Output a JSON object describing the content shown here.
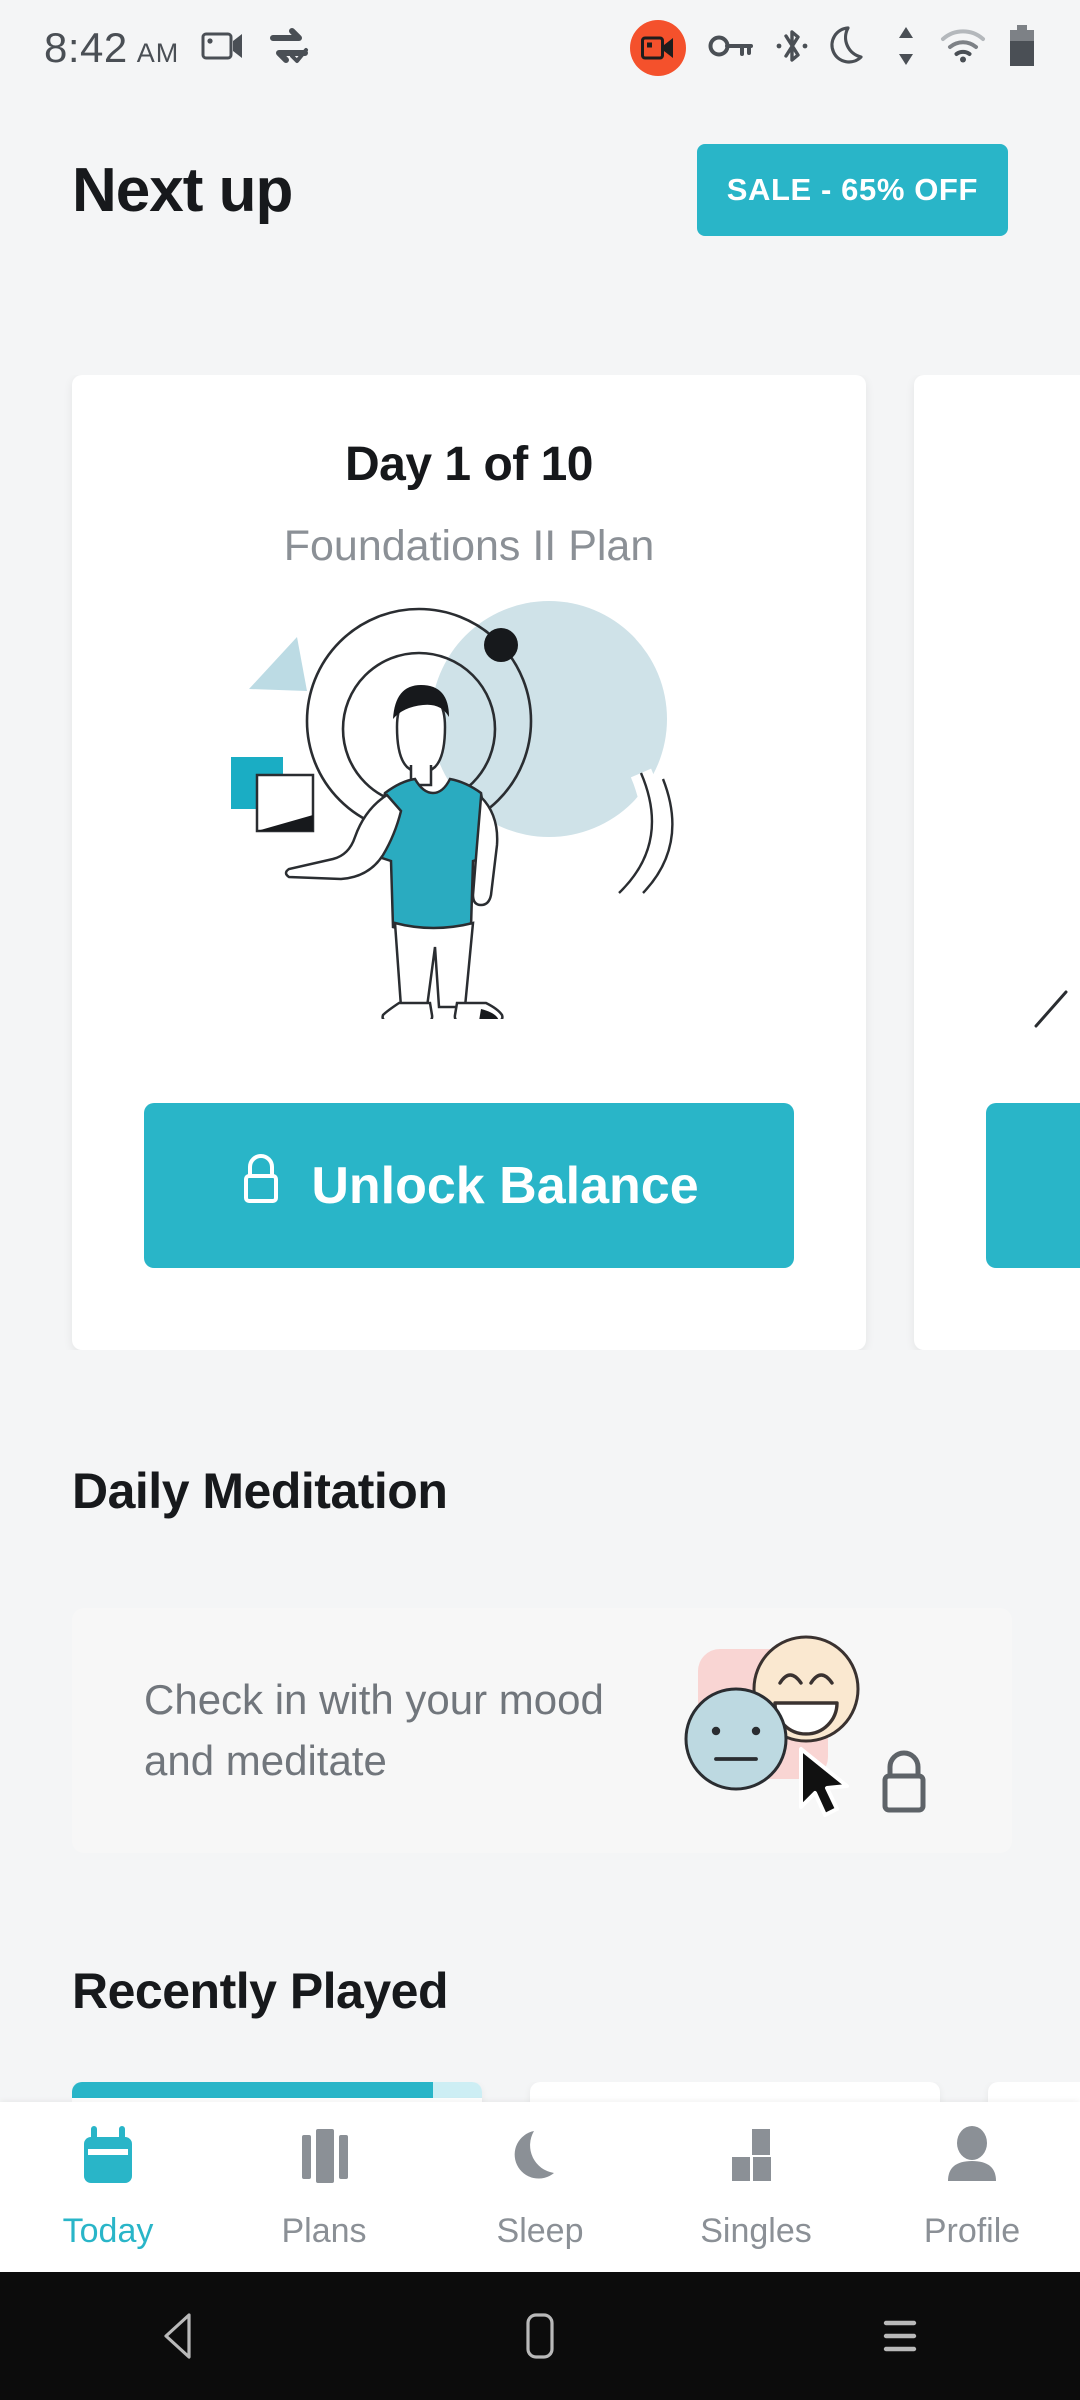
{
  "status_bar": {
    "time": "8:42",
    "ampm": "AM",
    "icons": [
      "screen-record-icon",
      "data-saver-check-icon",
      "recording-badge-icon",
      "vpn-key-icon",
      "bluetooth-icon",
      "do-not-disturb-moon-icon",
      "data-transfer-icon",
      "wifi-icon",
      "battery-icon"
    ],
    "recording_badge_color": "#f4512c"
  },
  "header": {
    "title": "Next up",
    "sale_label": "SALE - 65% OFF"
  },
  "theme": {
    "accent": "#29b5c8",
    "page_background": "#f4f5f6",
    "card_background": "#ffffff",
    "muted_text": "#8b9096",
    "heading_text": "#17191c"
  },
  "next_up": {
    "cards": [
      {
        "day_label": "Day 1 of 10",
        "plan_name": "Foundations II Plan",
        "button_label": "Unlock Balance",
        "button_icon": "lock-icon"
      },
      {
        "day_label": "",
        "plan_name": "",
        "button_label": "",
        "button_icon": "lock-icon"
      }
    ]
  },
  "daily_meditation": {
    "section_title": "Daily Meditation",
    "card_text": "Check in with your mood and meditate",
    "lock_icon": "lock-icon",
    "art": {
      "pink_swatch": "#f9d5d3",
      "happy_face": "#fae8d0",
      "neutral_face": "#bdd9e1"
    }
  },
  "recently_played": {
    "section_title": "Recently Played",
    "cards": [
      {
        "progress_percent": 88
      },
      {
        "progress_percent": 0
      },
      {
        "progress_percent": 0
      }
    ]
  },
  "bottom_nav": {
    "items": [
      {
        "label": "Today",
        "icon": "calendar-icon",
        "active": true
      },
      {
        "label": "Plans",
        "icon": "columns-icon",
        "active": false
      },
      {
        "label": "Sleep",
        "icon": "moon-icon",
        "active": false
      },
      {
        "label": "Singles",
        "icon": "blocks-icon",
        "active": false
      },
      {
        "label": "Profile",
        "icon": "person-icon",
        "active": false
      }
    ]
  },
  "system_nav": {
    "back": "back-triangle-icon",
    "home": "home-rect-icon",
    "recents": "recents-lines-icon"
  }
}
